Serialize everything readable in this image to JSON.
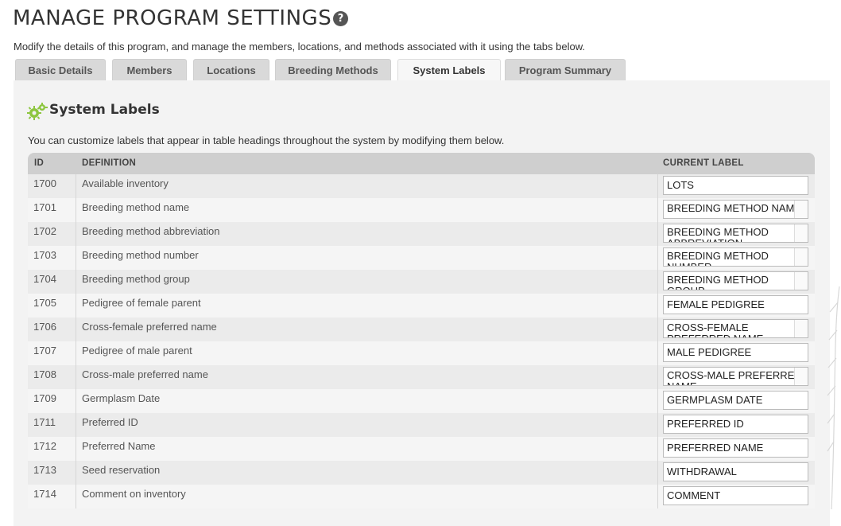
{
  "page": {
    "title": "MANAGE PROGRAM SETTINGS",
    "subtitle": "Modify the details of this program, and manage the members, locations, and methods associated with it using the tabs below."
  },
  "tabs": [
    {
      "label": "Basic Details"
    },
    {
      "label": "Members"
    },
    {
      "label": "Locations"
    },
    {
      "label": "Breeding Methods"
    },
    {
      "label": "System Labels",
      "active": true
    },
    {
      "label": "Program Summary"
    }
  ],
  "section": {
    "title": "System Labels",
    "description": "You can customize labels that appear in table headings throughout the system by modifying them below."
  },
  "table": {
    "headers": {
      "id": "ID",
      "definition": "DEFINITION",
      "current_label": "CURRENT LABEL"
    },
    "rows": [
      {
        "id": "1700",
        "definition": "Available inventory",
        "label": "LOTS"
      },
      {
        "id": "1701",
        "definition": "Breeding method name",
        "label": "BREEDING METHOD NAME"
      },
      {
        "id": "1702",
        "definition": "Breeding method abbreviation",
        "label": "BREEDING METHOD ABBREVIATION"
      },
      {
        "id": "1703",
        "definition": "Breeding method number",
        "label": "BREEDING METHOD NUMBER"
      },
      {
        "id": "1704",
        "definition": "Breeding method group",
        "label": "BREEDING METHOD GROUP"
      },
      {
        "id": "1705",
        "definition": "Pedigree of female parent",
        "label": "FEMALE PEDIGREE"
      },
      {
        "id": "1706",
        "definition": "Cross-female preferred name",
        "label": "CROSS-FEMALE PREFERRED NAME"
      },
      {
        "id": "1707",
        "definition": "Pedigree of male parent",
        "label": "MALE PEDIGREE"
      },
      {
        "id": "1708",
        "definition": "Cross-male preferred name",
        "label": "CROSS-MALE PREFERRED NAME"
      },
      {
        "id": "1709",
        "definition": "Germplasm Date",
        "label": "GERMPLASM DATE"
      },
      {
        "id": "1711",
        "definition": "Preferred ID",
        "label": "PREFERRED ID"
      },
      {
        "id": "1712",
        "definition": "Preferred Name",
        "label": "PREFERRED NAME"
      },
      {
        "id": "1713",
        "definition": "Seed reservation",
        "label": "WITHDRAWAL"
      },
      {
        "id": "1714",
        "definition": "Comment on inventory",
        "label": "COMMENT"
      }
    ]
  },
  "colors": {
    "accent_icon": "#8dc63f",
    "tab_inactive": "#d9d9d9",
    "header_bg": "#cfcfcf"
  },
  "icons": {
    "help": "question-circle-icon",
    "section": "gears-icon"
  }
}
